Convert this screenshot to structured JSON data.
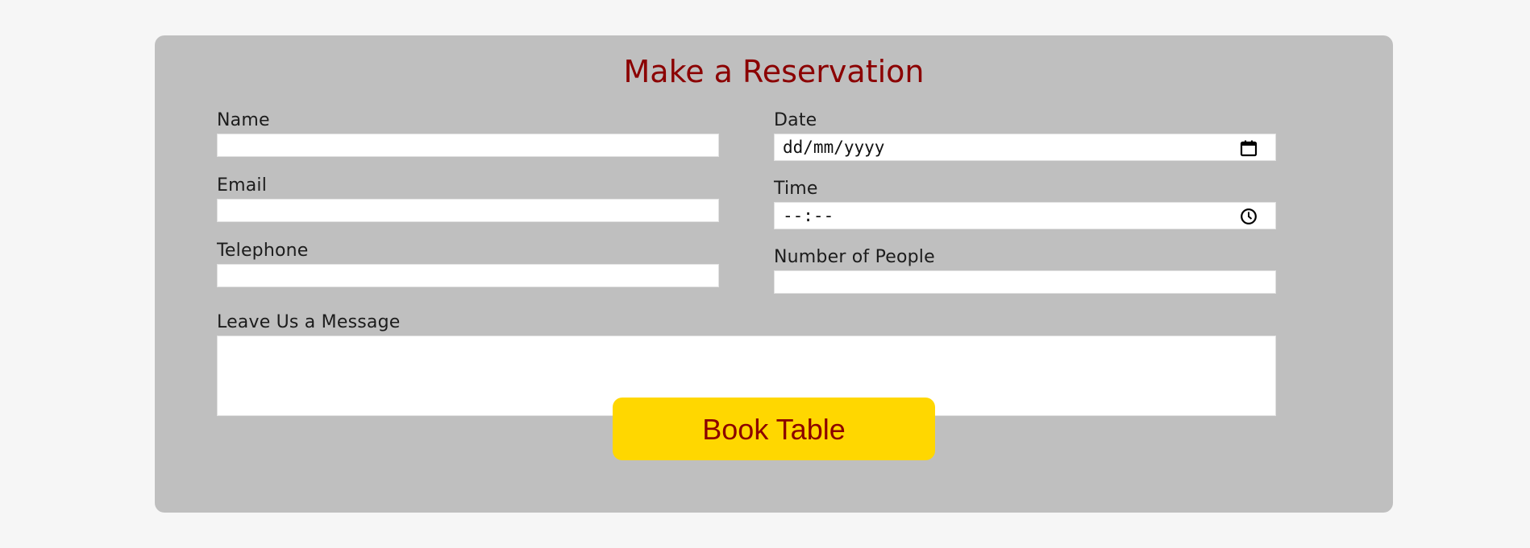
{
  "reservation": {
    "title": "Make a Reservation",
    "fields": {
      "name": {
        "label": "Name",
        "value": ""
      },
      "email": {
        "label": "Email",
        "value": ""
      },
      "telephone": {
        "label": "Telephone",
        "value": ""
      },
      "date": {
        "label": "Date",
        "placeholder": "dd/mm/yyyy",
        "icon": "calendar-icon"
      },
      "time": {
        "label": "Time",
        "placeholder": "--:--",
        "icon": "clock-icon"
      },
      "people": {
        "label": "Number of People",
        "value": ""
      },
      "message": {
        "label": "Leave Us a Message",
        "value": ""
      }
    },
    "submit_label": "Book Table"
  },
  "colors": {
    "page_background": "#f6f6f6",
    "card_background": "#bfbfbf",
    "title_color": "#8b0000",
    "button_background": "#ffd700",
    "button_text": "#8b0000"
  }
}
